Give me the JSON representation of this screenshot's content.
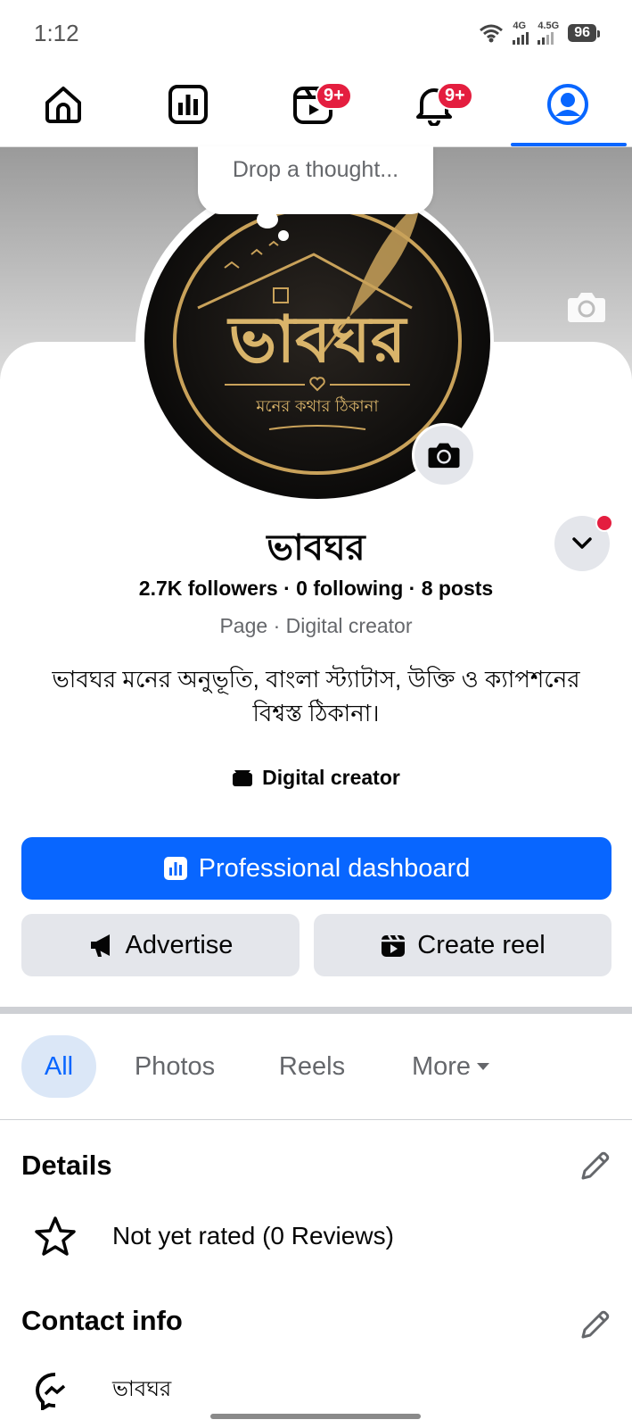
{
  "status_bar": {
    "time": "1:12",
    "network_1": "4G",
    "network_2": "4.5G",
    "battery": "96"
  },
  "nav": {
    "notifications_badge_reels": "9+",
    "notifications_badge_bell": "9+"
  },
  "thought": {
    "placeholder": "Drop a thought..."
  },
  "profile": {
    "name": "ভাবঘর",
    "stats": "2.7K followers · 0 following · 8 posts",
    "category": "Page · Digital creator",
    "bio": "ভাবঘর মনের অনুভূতি, বাংলা স্ট্যাটাস, উক্তি ও ক্যাপশনের বিশ্বস্ত ঠিকানা।",
    "creator_label": "Digital creator"
  },
  "logo": {
    "title": "ভাবঘর",
    "tagline": "মনের কথার ঠিকানা"
  },
  "buttons": {
    "dashboard": "Professional dashboard",
    "advertise": "Advertise",
    "create_reel": "Create reel"
  },
  "tabs": {
    "all": "All",
    "photos": "Photos",
    "reels": "Reels",
    "more": "More"
  },
  "details": {
    "title": "Details",
    "rating": "Not yet rated (0 Reviews)"
  },
  "contact": {
    "title": "Contact info",
    "messenger": "ভাবঘর"
  },
  "colors": {
    "accent": "#0866ff",
    "badge": "#e41e3f",
    "gold": "#c9a25a"
  }
}
